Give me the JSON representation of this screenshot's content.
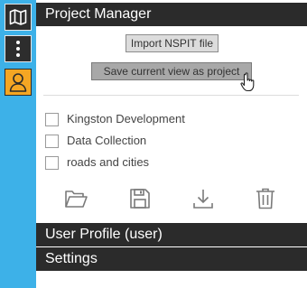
{
  "sidebar": {
    "buttons": [
      {
        "name": "map-icon"
      },
      {
        "name": "more-vertical-icon"
      },
      {
        "name": "user-icon"
      }
    ]
  },
  "project_manager": {
    "title": "Project Manager",
    "import_label": "Import NSPIT file",
    "save_view_label": "Save current view as project",
    "projects": [
      {
        "label": "Kingston Development",
        "checked": false
      },
      {
        "label": "Data Collection",
        "checked": false
      },
      {
        "label": "roads and cities",
        "checked": false
      }
    ],
    "actions": [
      "folder-open-icon",
      "save-icon",
      "download-icon",
      "trash-icon"
    ]
  },
  "user_profile": {
    "title": "User Profile (user)"
  },
  "settings": {
    "title": "Settings"
  },
  "colors": {
    "rail": "#3db1e8",
    "header_bg": "#2b2b2b",
    "user_accent": "#f5a623"
  }
}
